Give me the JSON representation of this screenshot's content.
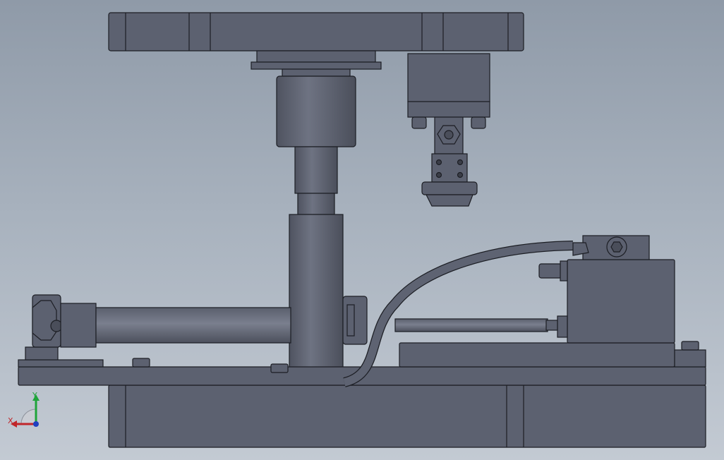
{
  "viewport": {
    "background_top": "#8f9aa8",
    "background_bottom": "#c3cad3",
    "part_fill": "#5c6170",
    "part_fill_light": "#6d7282",
    "edge_color": "#1c1e24"
  },
  "triad": {
    "x_label": "X",
    "y_label": "Y",
    "x_color": "#c0262a",
    "y_color": "#1fa43a",
    "z_color": "#2040c0"
  }
}
